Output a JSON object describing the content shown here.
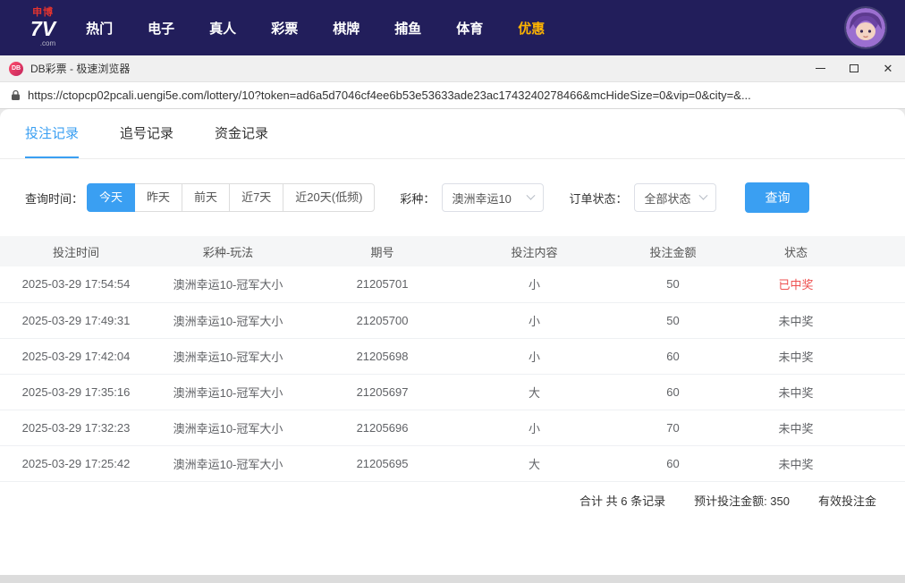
{
  "site_header": {
    "logo_top": "申博",
    "logo_main": "7V",
    "logo_suffix": ".com",
    "nav_items": [
      {
        "label": "热门"
      },
      {
        "label": "电子"
      },
      {
        "label": "真人"
      },
      {
        "label": "彩票"
      },
      {
        "label": "棋牌"
      },
      {
        "label": "捕鱼"
      },
      {
        "label": "体育"
      },
      {
        "label": "优惠"
      }
    ]
  },
  "browser": {
    "window_title": "DB彩票 - 极速浏览器",
    "favicon_text": "DB",
    "url": "https://ctopcp02pcali.uengi5e.com/lottery/10?token=ad6a5d7046cf4ee6b53e53633ade23ac1743240278466&mcHideSize=0&vip=0&city=&..."
  },
  "tabs": [
    {
      "label": "投注记录"
    },
    {
      "label": "追号记录"
    },
    {
      "label": "资金记录"
    }
  ],
  "filters": {
    "time_label": "查询时间：",
    "time_options": [
      {
        "label": "今天"
      },
      {
        "label": "昨天"
      },
      {
        "label": "前天"
      },
      {
        "label": "近7天"
      },
      {
        "label": "近20天(低频)"
      }
    ],
    "lottery_label": "彩种：",
    "lottery_selected": "澳洲幸运10",
    "status_label": "订单状态：",
    "status_selected": "全部状态",
    "query_button": "查询"
  },
  "table": {
    "headers": [
      "投注时间",
      "彩种-玩法",
      "期号",
      "投注内容",
      "投注金额",
      "状态"
    ],
    "rows": [
      {
        "time": "2025-03-29 17:54:54",
        "game": "澳洲幸运10-冠军大小",
        "issue": "21205701",
        "content": "小",
        "amount": "50",
        "status": "已中奖"
      },
      {
        "time": "2025-03-29 17:49:31",
        "game": "澳洲幸运10-冠军大小",
        "issue": "21205700",
        "content": "小",
        "amount": "50",
        "status": "未中奖"
      },
      {
        "time": "2025-03-29 17:42:04",
        "game": "澳洲幸运10-冠军大小",
        "issue": "21205698",
        "content": "小",
        "amount": "60",
        "status": "未中奖"
      },
      {
        "time": "2025-03-29 17:35:16",
        "game": "澳洲幸运10-冠军大小",
        "issue": "21205697",
        "content": "大",
        "amount": "60",
        "status": "未中奖"
      },
      {
        "time": "2025-03-29 17:32:23",
        "game": "澳洲幸运10-冠军大小",
        "issue": "21205696",
        "content": "小",
        "amount": "70",
        "status": "未中奖"
      },
      {
        "time": "2025-03-29 17:25:42",
        "game": "澳洲幸运10-冠军大小",
        "issue": "21205695",
        "content": "大",
        "amount": "60",
        "status": "未中奖"
      }
    ]
  },
  "summary": {
    "total_text": "合计 共 6 条记录",
    "expected_text": "预计投注金额: 350",
    "valid_text_clipped": "有效投注金"
  },
  "colors": {
    "accent_blue": "#3a9ff2",
    "win_red": "#ee4f4f",
    "header_bg": "#221e5b",
    "highlight_gold": "#ffb400"
  }
}
